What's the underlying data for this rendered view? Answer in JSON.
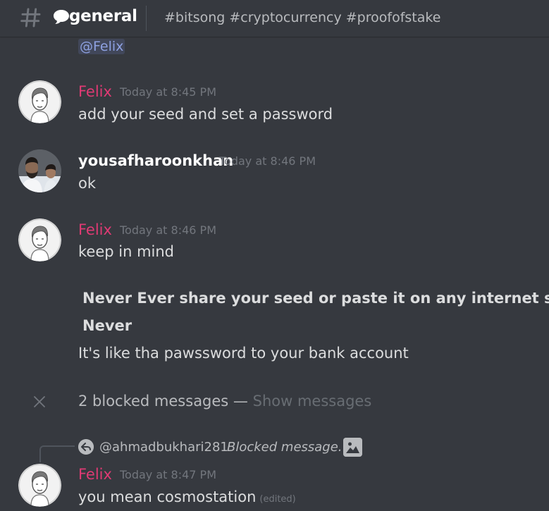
{
  "header": {
    "hash_icon": "hashtag-icon",
    "channel_icon": "speech-bubble-icon",
    "channel_name": "general",
    "topic": "#bitsong #cryptocurrency #proofofstake"
  },
  "top_mention": "@Felix",
  "messages": [
    {
      "author": "Felix",
      "timestamp": "Today at 8:45 PM",
      "lines": [
        "add your seed and set a password"
      ]
    },
    {
      "author": "yousafharoonkhan",
      "timestamp": "Today at 8:46 PM",
      "lines": [
        "ok"
      ]
    },
    {
      "author": "Felix",
      "timestamp": "Today at 8:46 PM",
      "lines": [
        "keep in mind"
      ],
      "bold_lines": [
        "Never Ever share your seed or paste it on any internet site",
        "Never"
      ],
      "trailing_line": "It's like tha pawssword to your bank account"
    }
  ],
  "blocked": {
    "text": "2 blocked messages —",
    "link": "Show messages"
  },
  "reply": {
    "user": "@ahmadbukhari281",
    "text": "Blocked message.",
    "icon": "image-icon"
  },
  "last_message": {
    "author": "Felix",
    "timestamp": "Today at 8:47 PM",
    "text": "you mean cosmostation",
    "edited": "(edited)"
  },
  "colors": {
    "background": "#36393f",
    "felix_name": "#e03a74",
    "mention": "#8ea1e1",
    "muted": "#72767d"
  }
}
